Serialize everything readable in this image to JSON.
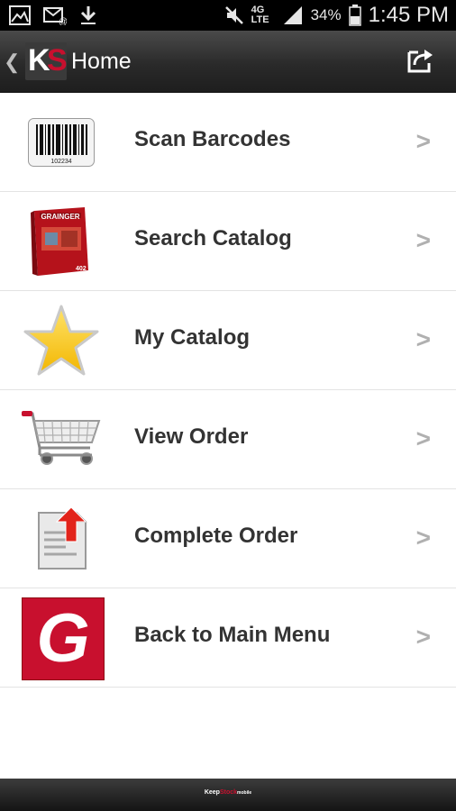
{
  "status_bar": {
    "network": "4G LTE",
    "battery": "34%",
    "time": "1:45 PM"
  },
  "action_bar": {
    "back_glyph": "❮",
    "logo_k": "K",
    "logo_s": "S",
    "title": "Home",
    "export_icon": "export-icon"
  },
  "menu": {
    "items": [
      {
        "label": "Scan Barcodes",
        "icon": "barcode-icon",
        "chevron": ">"
      },
      {
        "label": "Search Catalog",
        "icon": "catalog-book-icon",
        "chevron": ">"
      },
      {
        "label": "My Catalog",
        "icon": "star-icon",
        "chevron": ">"
      },
      {
        "label": "View Order",
        "icon": "shopping-cart-icon",
        "chevron": ">"
      },
      {
        "label": "Complete Order",
        "icon": "upload-document-icon",
        "chevron": ">"
      },
      {
        "label": "Back to Main Menu",
        "icon": "grainger-logo-icon",
        "chevron": ">"
      }
    ]
  },
  "icon_text": {
    "barcode_number": "102234",
    "catalog_brand": "GRAINGER",
    "catalog_number": "402",
    "grainger_letter": "G"
  },
  "bottom_bar": {
    "brand_part1": "Keep",
    "brand_part2": "Stock",
    "brand_suffix": "mobile"
  },
  "colors": {
    "brand_red": "#c8102e",
    "label_text": "#333333",
    "chevron": "#b0b0b0",
    "divider": "#e3e3e3"
  }
}
